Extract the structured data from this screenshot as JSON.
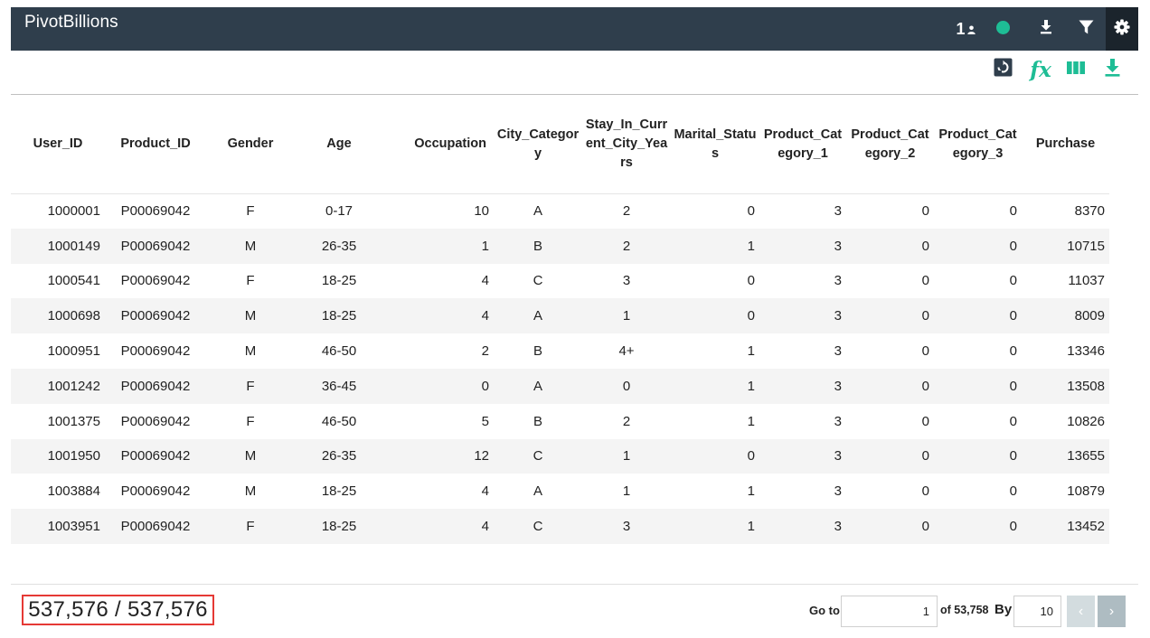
{
  "app": {
    "title": "PivotBillions"
  },
  "topbar": {
    "user_count": "1",
    "icons": [
      "person-icon",
      "status-dot-icon",
      "download-icon",
      "filter-icon",
      "gear-icon"
    ],
    "status_color": "#1ebd95"
  },
  "table_toolbar": {
    "icons": [
      "refresh-view-icon",
      "formula-icon",
      "columns-icon",
      "download-icon"
    ],
    "fx_label": "fx",
    "accent": "#1ebd95"
  },
  "table": {
    "columns": [
      "User_ID",
      "Product_ID",
      "Gender",
      "Age",
      "Occupation",
      "City_Category",
      "Stay_In_Current_City_Years",
      "Marital_Status",
      "Product_Category_1",
      "Product_Category_2",
      "Product_Category_3",
      "Purchase"
    ],
    "rows": [
      [
        "1000001",
        "P00069042",
        "F",
        "0-17",
        "10",
        "A",
        "2",
        "0",
        "3",
        "0",
        "0",
        "8370"
      ],
      [
        "1000149",
        "P00069042",
        "M",
        "26-35",
        "1",
        "B",
        "2",
        "1",
        "3",
        "0",
        "0",
        "10715"
      ],
      [
        "1000541",
        "P00069042",
        "F",
        "18-25",
        "4",
        "C",
        "3",
        "0",
        "3",
        "0",
        "0",
        "11037"
      ],
      [
        "1000698",
        "P00069042",
        "M",
        "18-25",
        "4",
        "A",
        "1",
        "0",
        "3",
        "0",
        "0",
        "8009"
      ],
      [
        "1000951",
        "P00069042",
        "M",
        "46-50",
        "2",
        "B",
        "4+",
        "1",
        "3",
        "0",
        "0",
        "13346"
      ],
      [
        "1001242",
        "P00069042",
        "F",
        "36-45",
        "0",
        "A",
        "0",
        "1",
        "3",
        "0",
        "0",
        "13508"
      ],
      [
        "1001375",
        "P00069042",
        "F",
        "46-50",
        "5",
        "B",
        "2",
        "1",
        "3",
        "0",
        "0",
        "10826"
      ],
      [
        "1001950",
        "P00069042",
        "M",
        "26-35",
        "12",
        "C",
        "1",
        "0",
        "3",
        "0",
        "0",
        "13655"
      ],
      [
        "1003884",
        "P00069042",
        "M",
        "18-25",
        "4",
        "A",
        "1",
        "1",
        "3",
        "0",
        "0",
        "10879"
      ],
      [
        "1003951",
        "P00069042",
        "F",
        "18-25",
        "4",
        "C",
        "3",
        "1",
        "3",
        "0",
        "0",
        "13452"
      ]
    ]
  },
  "footer": {
    "counter": "537,576 / 537,576",
    "goto_label": "Go to",
    "page_value": "1",
    "of_label": "of 53,758",
    "by_label": "By",
    "page_size_value": "10",
    "prev_icon": "chevron-left-icon",
    "next_icon": "chevron-right-icon"
  }
}
